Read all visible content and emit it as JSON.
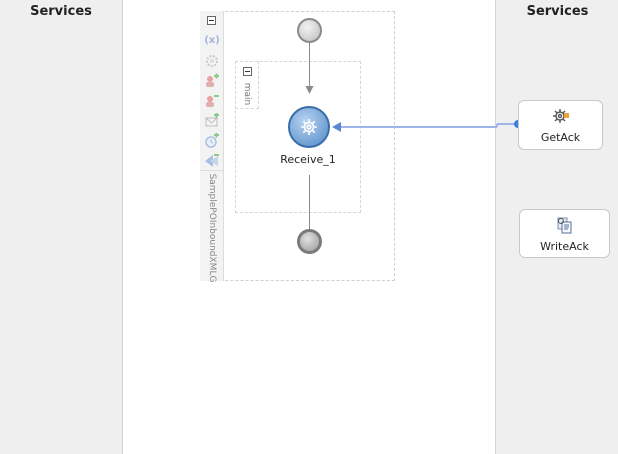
{
  "lanes": {
    "left_title": "Services",
    "right_title": "Services"
  },
  "process": {
    "name": "SamplePOInboundXMLG",
    "sequence_label": "main",
    "receive_label": "Receive_1"
  },
  "services": [
    {
      "label": "GetAck",
      "icon": "gear-service-icon"
    },
    {
      "label": "WriteAck",
      "icon": "file-adapter-icon"
    }
  ],
  "toolbar_icons": [
    "variables-icon",
    "correlation-icon",
    "partner-link-add-icon",
    "partner-link-remove-icon",
    "message-handler-icon",
    "alarm-handler-icon",
    "fault-handler-icon"
  ],
  "colors": {
    "lane_bg": "#efefef",
    "receive_fill": "#4f87c6",
    "wire": "#9fb4e8",
    "wire_endpoint": "#3d7fe0"
  }
}
